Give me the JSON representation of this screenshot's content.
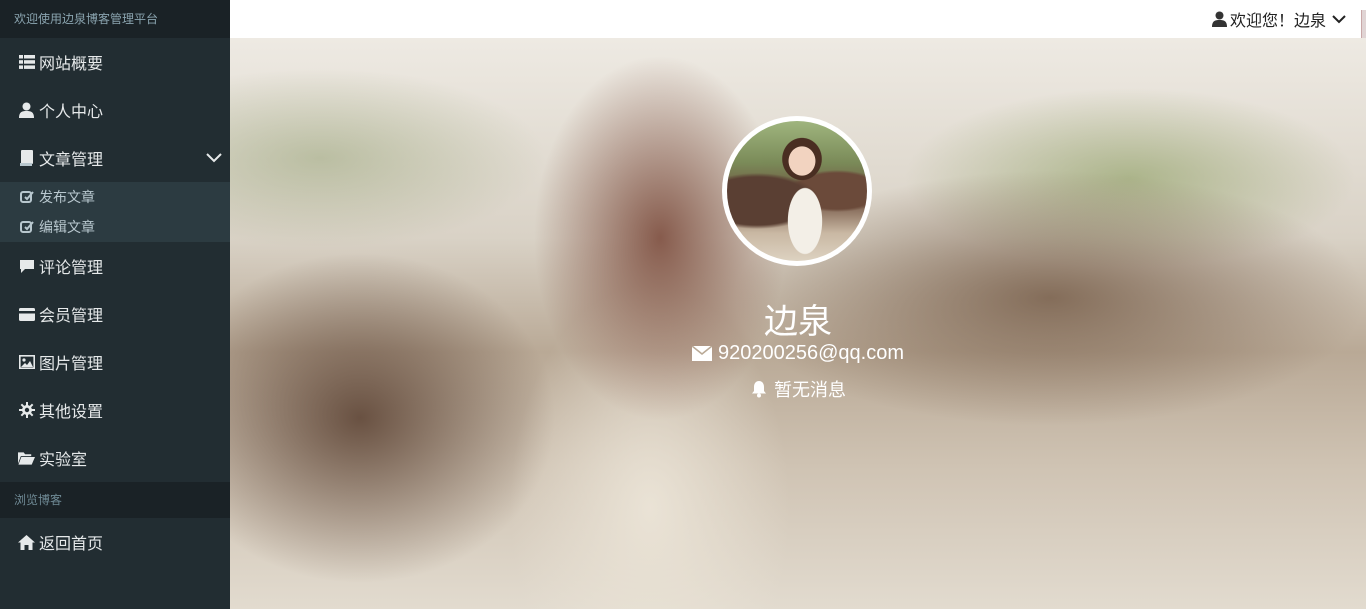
{
  "sidebar": {
    "header": "欢迎使用边泉博客管理平台",
    "items": [
      {
        "label": "网站概要",
        "icon": "list-icon"
      },
      {
        "label": "个人中心",
        "icon": "user-icon"
      },
      {
        "label": "文章管理",
        "icon": "book-icon",
        "expanded": true
      },
      {
        "label": "评论管理",
        "icon": "comment-icon"
      },
      {
        "label": "会员管理",
        "icon": "credit-card-icon"
      },
      {
        "label": "图片管理",
        "icon": "picture-icon"
      },
      {
        "label": "其他设置",
        "icon": "gear-icon"
      },
      {
        "label": "实验室",
        "icon": "folder-open-icon"
      }
    ],
    "subitems": [
      {
        "label": "发布文章",
        "icon": "edit-icon"
      },
      {
        "label": "编辑文章",
        "icon": "edit-icon"
      }
    ],
    "section_label": "浏览博客",
    "home_link": {
      "label": "返回首页",
      "icon": "home-icon"
    }
  },
  "topbar": {
    "user_menu_label": "欢迎您！边泉"
  },
  "profile": {
    "name": "边泉",
    "email": "920200256@qq.com",
    "message": "暂无消息"
  },
  "colors": {
    "sidebar_bg": "#222d32",
    "sidebar_header_bg": "#1a2226",
    "submenu_bg": "#2c3b41",
    "topbar_bg": "#ffffff"
  }
}
